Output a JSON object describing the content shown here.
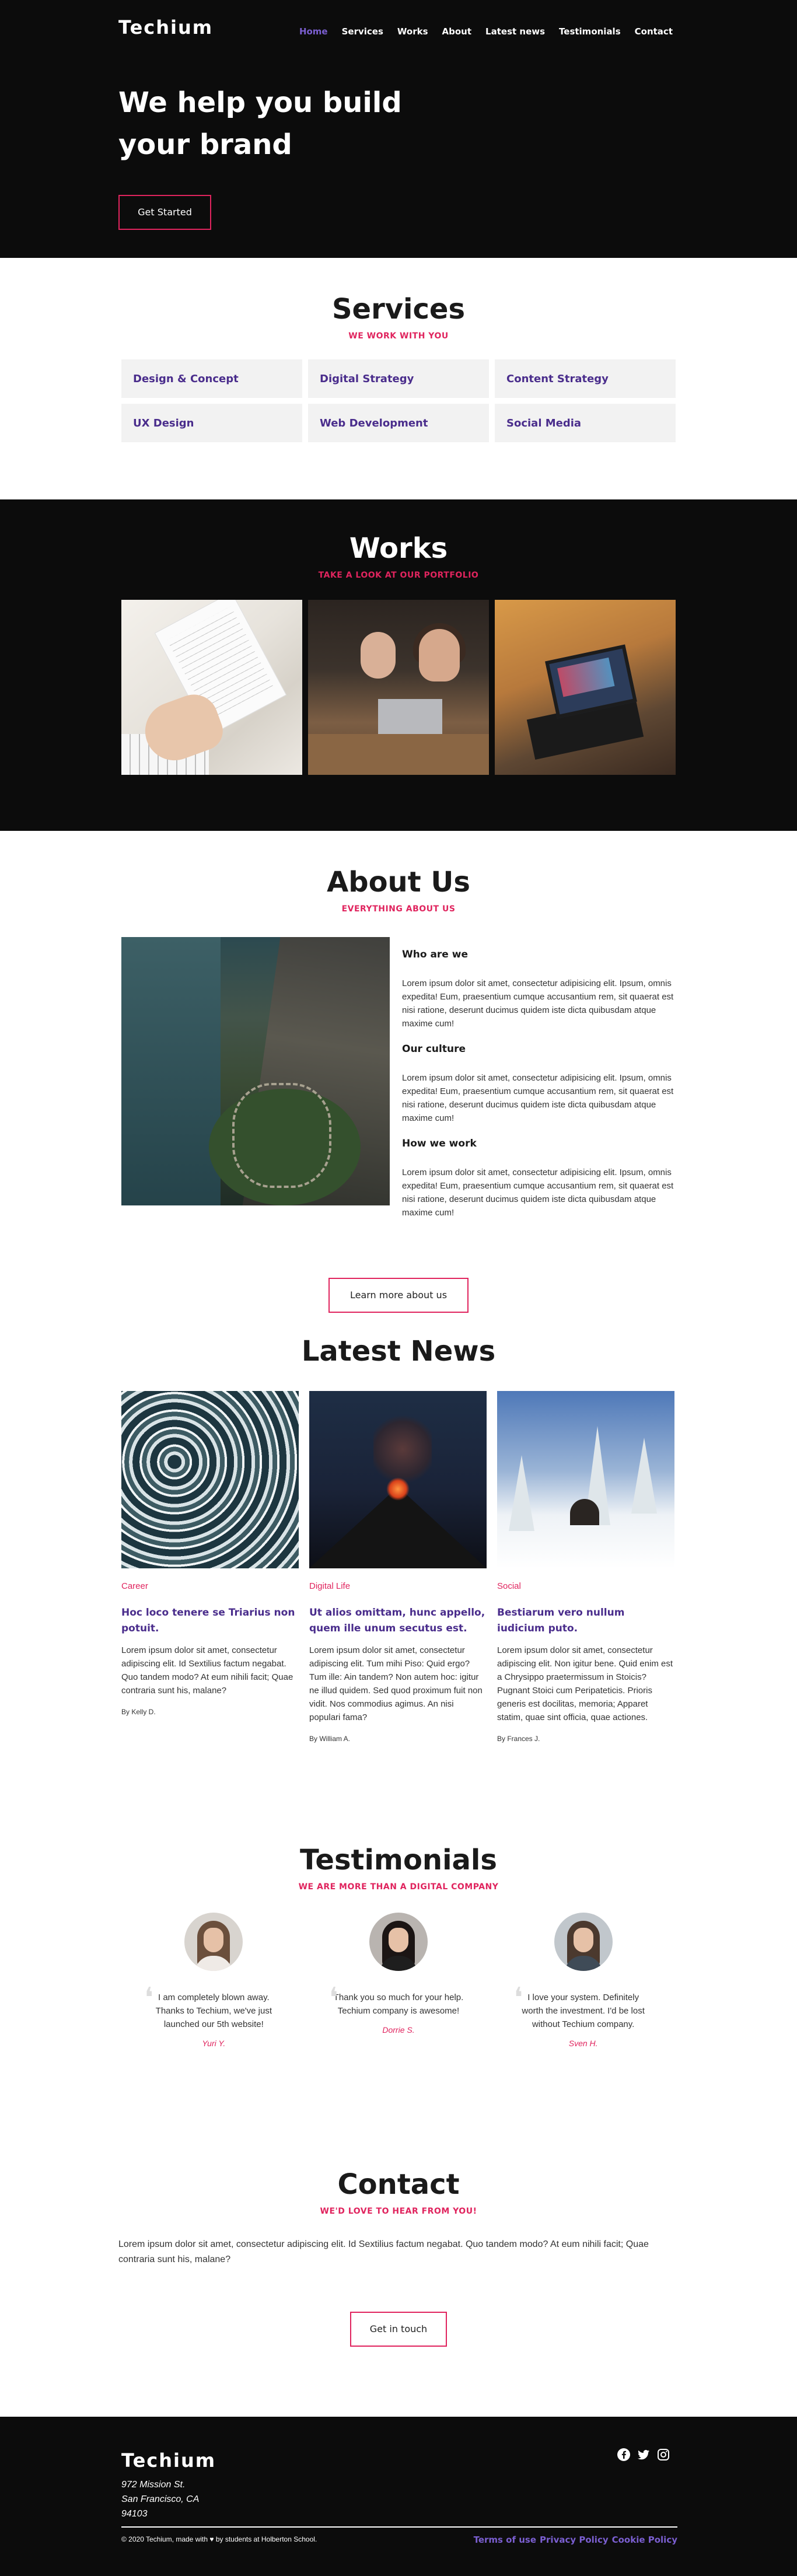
{
  "header": {
    "brand": "Techium",
    "nav": [
      "Home",
      "Services",
      "Works",
      "About",
      "Latest news",
      "Testimonials",
      "Contact"
    ],
    "active_nav": "Home",
    "hero_title": "We help you build your brand",
    "hero_button": "Get Started"
  },
  "services": {
    "title": "Services",
    "subtitle": "WE WORK WITH YOU",
    "items": [
      "Design & Concept",
      "Digital Strategy",
      "Content Strategy",
      "UX Design",
      "Web Development",
      "Social Media"
    ]
  },
  "works": {
    "title": "Works",
    "subtitle": "TAKE A LOOK AT OUR PORTFOLIO"
  },
  "about": {
    "title": "About Us",
    "subtitle": "EVERYTHING ABOUT US",
    "blocks": [
      {
        "heading": "Who are we",
        "text": "Lorem ipsum dolor sit amet, consectetur adipisicing elit. Ipsum, omnis expedita! Eum, praesentium cumque accusantium rem, sit quaerat est nisi ratione, deserunt ducimus quidem iste dicta quibusdam atque maxime cum!"
      },
      {
        "heading": "Our culture",
        "text": "Lorem ipsum dolor sit amet, consectetur adipisicing elit. Ipsum, omnis expedita! Eum, praesentium cumque accusantium rem, sit quaerat est nisi ratione, deserunt ducimus quidem iste dicta quibusdam atque maxime cum!"
      },
      {
        "heading": "How we work",
        "text": "Lorem ipsum dolor sit amet, consectetur adipisicing elit. Ipsum, omnis expedita! Eum, praesentium cumque accusantium rem, sit quaerat est nisi ratione, deserunt ducimus quidem iste dicta quibusdam atque maxime cum!"
      }
    ],
    "button": "Learn more about us"
  },
  "news": {
    "title": "Latest News",
    "items": [
      {
        "category": "Career",
        "title": "Hoc loco tenere se Triarius non potuit.",
        "body": "Lorem ipsum dolor sit amet, consectetur adipiscing elit. Id Sextilius factum negabat. Quo tandem modo? At eum nihili facit; Quae contraria sunt his, malane?",
        "author": "By Kelly D."
      },
      {
        "category": "Digital Life",
        "title": "Ut alios omittam, hunc appello, quem ille unum secutus est.",
        "body": "Lorem ipsum dolor sit amet, consectetur adipiscing elit. Tum mihi Piso: Quid ergo? Tum ille: Ain tandem? Non autem hoc: igitur ne illud quidem. Sed quod proximum fuit non vidit. Nos commodius agimus. An nisi populari fama?",
        "author": "By William A."
      },
      {
        "category": "Social",
        "title": "Bestiarum vero nullum iudicium puto.",
        "body": "Lorem ipsum dolor sit amet, consectetur adipiscing elit. Non igitur bene. Quid enim est a Chrysippo praetermissum in Stoicis? Pugnant Stoici cum Peripateticis. Prioris generis est docilitas, memoria; Apparet statim, quae sint officia, quae actiones.",
        "author": "By Frances J."
      }
    ]
  },
  "testimonials": {
    "title": "Testimonials",
    "subtitle": "WE ARE MORE THAN A DIGITAL COMPANY",
    "items": [
      {
        "quote": "I am completely blown away. Thanks to Techium, we've just launched our 5th website!",
        "name": "Yuri Y."
      },
      {
        "quote": "Thank you so much for your help. Techium company is awesome!",
        "name": "Dorrie S."
      },
      {
        "quote": "I love your system. Definitely worth the investment. I'd be lost without Techium company.",
        "name": "Sven H."
      }
    ]
  },
  "contact": {
    "title": "Contact",
    "subtitle": "WE'D LOVE TO HEAR FROM YOU!",
    "text": "Lorem ipsum dolor sit amet, consectetur adipiscing elit. Id Sextilius factum negabat. Quo tandem modo? At eum nihili facit; Quae contraria sunt his, malane?",
    "button": "Get in touch"
  },
  "footer": {
    "brand": "Techium",
    "address": [
      "972 Mission St.",
      "San Francisco, CA",
      "94103"
    ],
    "social_icons": [
      "facebook-icon",
      "twitter-icon",
      "instagram-icon"
    ],
    "copyright": "© 2020 Techium, made with ♥ by students at Holberton School.",
    "links": [
      "Terms of use",
      "Privacy Policy",
      "Cookie Policy"
    ],
    "link_color": "#7b5fd1"
  },
  "colors": {
    "accent": "#e0245e",
    "purple": "#4a2d8c",
    "dark": "#0c0c0c"
  }
}
